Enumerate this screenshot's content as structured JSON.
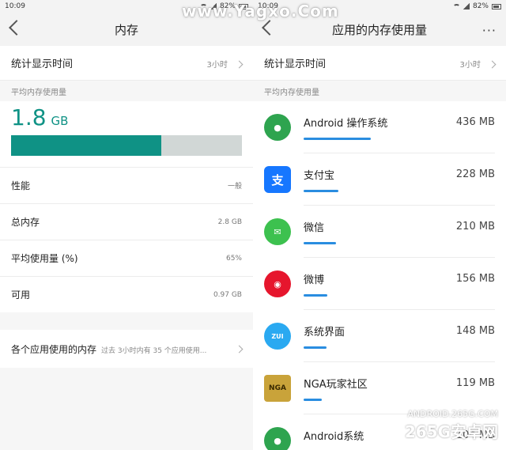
{
  "left": {
    "status": {
      "time": "10:09",
      "battery": "82%"
    },
    "title": "内存",
    "stat_time": {
      "label": "统计显示时间",
      "value": "3小时"
    },
    "section_label": "平均内存使用量",
    "memory": {
      "value": "1.8",
      "unit": "GB",
      "used_fraction": 0.65
    },
    "rows": [
      {
        "label": "性能",
        "value": "一般"
      },
      {
        "label": "总内存",
        "value": "2.8 GB"
      },
      {
        "label": "平均使用量 (%)",
        "value": "65%"
      },
      {
        "label": "可用",
        "value": "0.97 GB"
      }
    ],
    "per_app": {
      "label": "各个应用使用的内存",
      "sub": "过去 3小时内有 35 个应用使用..."
    }
  },
  "right": {
    "status": {
      "time": "10:09",
      "battery": "82%"
    },
    "title": "应用的内存使用量",
    "more": "···",
    "stat_time": {
      "label": "统计显示时间",
      "value": "3小时"
    },
    "section_label": "平均内存使用量",
    "apps": [
      {
        "name": "Android 操作系统",
        "size": "436 MB",
        "mb": 436,
        "icon": "android-os-icon",
        "color": "#2ea44f"
      },
      {
        "name": "支付宝",
        "size": "228 MB",
        "mb": 228,
        "icon": "alipay-icon",
        "color": "#1677ff"
      },
      {
        "name": "微信",
        "size": "210 MB",
        "mb": 210,
        "icon": "wechat-icon",
        "color": "#3dc14f"
      },
      {
        "name": "微博",
        "size": "156 MB",
        "mb": 156,
        "icon": "weibo-icon",
        "color": "#e6162d"
      },
      {
        "name": "系统界面",
        "size": "148 MB",
        "mb": 148,
        "icon": "zui-icon",
        "color": "#2aa9f1"
      },
      {
        "name": "NGA玩家社区",
        "size": "119 MB",
        "mb": 119,
        "icon": "nga-icon",
        "color": "#c9a33a"
      },
      {
        "name": "Android系统",
        "size": "104 MB",
        "mb": 104,
        "icon": "android-system-icon",
        "color": "#2ea44f"
      }
    ]
  },
  "watermark": {
    "top": "www.Yagxo.Com",
    "br1": "ANDROID.265G.COM",
    "br2": "265G安卓网"
  },
  "colors": {
    "accent": "#0f9285",
    "bar_bg": "#d1d7d6",
    "progress": "#2a8de0"
  }
}
